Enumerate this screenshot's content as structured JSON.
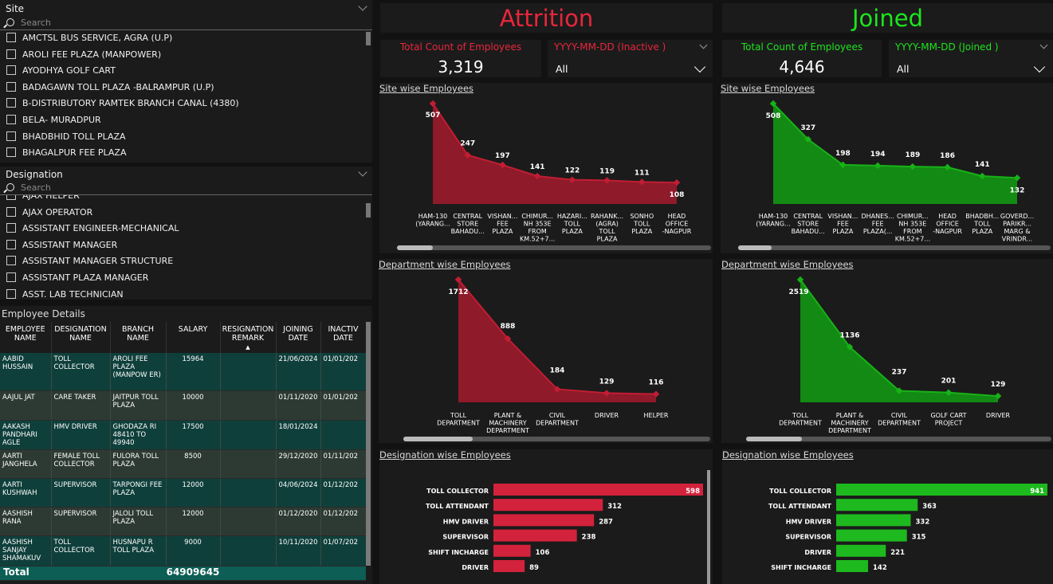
{
  "site_slicer": {
    "title": "Site",
    "search_placeholder": "Search",
    "items": [
      "AMCTSL BUS SERVICE, AGRA (U.P)",
      "AROLI FEE PLAZA (MANPOWER)",
      "AYODHYA GOLF CART",
      "BADAGAWN TOLL PLAZA -BALRAMPUR (U.P)",
      "B-DISTRIBUTORY RAMTEK BRANCH CANAL (4380)",
      "BELA- MURADPUR",
      "BHADBHID TOLL PLAZA",
      "BHAGALPUR FEE PLAZA"
    ]
  },
  "designation_slicer": {
    "title": "Designation",
    "search_placeholder": "Search",
    "items": [
      "AJAX HELPER",
      "AJAX OPERATOR",
      "ASSISTANT ENGINEER-MECHANICAL",
      "ASSISTANT MANAGER",
      "ASSISTANT MANAGER STRUCTURE",
      "ASSISTANT PLAZA MANAGER",
      "ASST. LAB TECHNICIAN"
    ]
  },
  "employee_table": {
    "title": "Employee Details",
    "columns": [
      "EMPLOYEE NAME",
      "DESIGNATION NAME",
      "BRANCH NAME",
      "SALARY",
      "RESIGNATION REMARK",
      "JOINING DATE",
      "INACTIVE DATE"
    ],
    "col_labels": [
      [
        "EMPLOYEE",
        "NAME"
      ],
      [
        "DESIGNATION",
        "NAME"
      ],
      [
        "BRANCH",
        "NAME"
      ],
      [
        "SALARY",
        ""
      ],
      [
        "RESIGNATION",
        "REMARK"
      ],
      [
        "JOINING",
        "DATE"
      ],
      [
        "INACTIV",
        "DATE"
      ]
    ],
    "rows": [
      {
        "name": "AABID HUSSAIN",
        "designation": "TOLL COLLECTOR",
        "branch": "AROLI FEE PLAZA (MANPOW ER)",
        "salary": "15964",
        "remark": "",
        "joining": "21/06/2024",
        "inactive": "01/01/202"
      },
      {
        "name": "AAJUL JAT",
        "designation": "CARE TAKER",
        "branch": "JAITPUR TOLL PLAZA",
        "salary": "10000",
        "remark": "",
        "joining": "01/11/2020",
        "inactive": "01/01/202"
      },
      {
        "name": "AAKASH PANDHARI AGLE",
        "designation": "HMV DRIVER",
        "branch": "GHODAZA RI 48410 TO 49940",
        "salary": "17500",
        "remark": "",
        "joining": "18/01/2024",
        "inactive": ""
      },
      {
        "name": "AARTI JANGHELA",
        "designation": "FEMALE TOLL COLLECTOR",
        "branch": "FULORA TOLL PLAZA",
        "salary": "8500",
        "remark": "",
        "joining": "29/12/2020",
        "inactive": "01/11/202"
      },
      {
        "name": "AARTI KUSHWAH",
        "designation": "SUPERVISOR",
        "branch": "TARPONGI FEE PLAZA",
        "salary": "12000",
        "remark": "",
        "joining": "04/06/2024",
        "inactive": "01/12/202"
      },
      {
        "name": "AASHISH RANA",
        "designation": "SUPERVISOR",
        "branch": "JALOLI TOLL PLAZA",
        "salary": "12000",
        "remark": "",
        "joining": "01/12/2020",
        "inactive": "01/12/202"
      },
      {
        "name": "AASHISH SANJAY SHAMAKUV",
        "designation": "TOLL COLLECTOR",
        "branch": "HUSNAPU R TOLL PLAZA",
        "salary": "9000",
        "remark": "",
        "joining": "10/11/2020",
        "inactive": "01/07/202"
      }
    ],
    "total_label": "Total",
    "total_salary": "64909645"
  },
  "attrition": {
    "title": "Attrition",
    "title_color": "#e8263c",
    "card_label": "Total Count of Employees",
    "card_value": "3,319",
    "date_filter_label": "YYYY-MM-DD (Inactive )",
    "date_filter_value": "All",
    "site_title": "Site wise Employees",
    "dept_title": "Department wise Employees",
    "desig_title": "Designation wise Employees"
  },
  "joined": {
    "title": "Joined",
    "title_color": "#1ee41e",
    "card_label": "Total Count of Employees",
    "card_value": "4,646",
    "date_filter_label": "YYYY-MM-DD (Joined )",
    "date_filter_value": "All",
    "site_title": "Site wise Employees",
    "dept_title": "Department wise Employees",
    "desig_title": "Designation wise Employees"
  },
  "colors": {
    "red": "#c21d33",
    "red_fill": "#8e1a2a",
    "green": "#17b217",
    "green_fill": "#138a13"
  },
  "chart_data": [
    {
      "id": "att-site",
      "type": "area",
      "categories": [
        [
          "HAM-130",
          "(YARANG..."
        ],
        [
          "CENTRAL",
          "STORE",
          "BAHADU..."
        ],
        [
          "VISHAN...",
          "FEE",
          "PLAZA"
        ],
        [
          "CHIMUR...",
          "NH 353E",
          "FROM",
          "KM.52+7..."
        ],
        [
          "HAZARI...",
          "TOLL",
          "PLAZA"
        ],
        [
          "RAHANK...",
          "(AGRA)",
          "TOLL",
          "PLAZA"
        ],
        [
          "SONHO",
          "TOLL",
          "PLAZA"
        ],
        [
          "HEAD",
          "OFFICE",
          "-NAGPUR"
        ]
      ],
      "values": [
        507,
        247,
        197,
        141,
        122,
        119,
        111,
        108
      ]
    },
    {
      "id": "join-site",
      "type": "area",
      "categories": [
        [
          "HAM-130",
          "(YARANG..."
        ],
        [
          "CENTRAL",
          "STORE",
          "BAHADU..."
        ],
        [
          "VISHAN...",
          "FEE",
          "PLAZA"
        ],
        [
          "DHANES...",
          "FEE",
          "PLAZA(..."
        ],
        [
          "CHIMUR...",
          "NH 353E",
          "FROM",
          "KM.52+7..."
        ],
        [
          "HEAD",
          "OFFICE",
          "-NAGPUR"
        ],
        [
          "BHADBH...",
          "TOLL",
          "PLAZA"
        ],
        [
          "GOVERD...",
          "PARIKR...",
          "MARG &",
          "VRINDR..."
        ]
      ],
      "values": [
        508,
        327,
        198,
        194,
        189,
        186,
        141,
        132
      ]
    },
    {
      "id": "att-dept",
      "type": "area",
      "categories": [
        [
          "TOLL",
          "DEPARTMENT"
        ],
        [
          "PLANT &",
          "MACHINERY",
          "DEPARTMENT"
        ],
        [
          "CIVIL",
          "DEPARTMENT"
        ],
        [
          "DRIVER"
        ],
        [
          "HELPER"
        ]
      ],
      "values": [
        1712,
        888,
        184,
        129,
        116
      ]
    },
    {
      "id": "join-dept",
      "type": "area",
      "categories": [
        [
          "TOLL",
          "DEPARTMENT"
        ],
        [
          "PLANT &",
          "MACHINERY",
          "DEPARTMENT"
        ],
        [
          "CIVIL",
          "DEPARTMENT"
        ],
        [
          "GOLF CART",
          "PROJECT"
        ],
        [
          "DRIVER"
        ]
      ],
      "values": [
        2519,
        1136,
        237,
        201,
        129
      ]
    },
    {
      "id": "att-desig",
      "type": "bar",
      "categories": [
        "TOLL COLLECTOR",
        "TOLL ATTENDANT",
        "HMV DRIVER",
        "SUPERVISOR",
        "SHIFT INCHARGE",
        "DRIVER"
      ],
      "values": [
        598,
        312,
        287,
        238,
        106,
        89
      ]
    },
    {
      "id": "join-desig",
      "type": "bar",
      "categories": [
        "TOLL COLLECTOR",
        "TOLL ATTENDANT",
        "HMV DRIVER",
        "SUPERVISOR",
        "DRIVER",
        "SHIFT INCHARGE"
      ],
      "values": [
        941,
        363,
        332,
        315,
        221,
        142
      ]
    }
  ]
}
